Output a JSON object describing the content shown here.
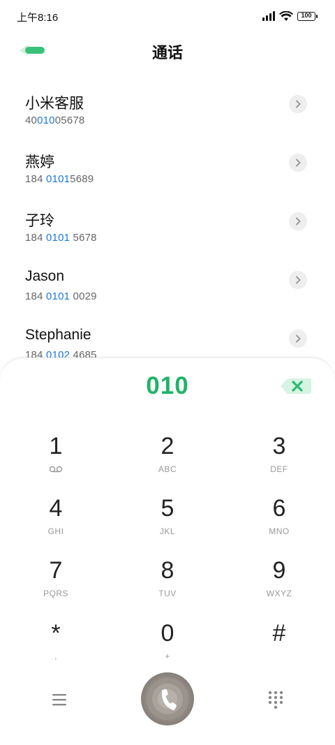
{
  "status_bar": {
    "time": "上午8:16",
    "battery": "100"
  },
  "header": {
    "title": "通话"
  },
  "contacts": [
    {
      "name": "小米客服",
      "number_pre": "40",
      "number_hl": "010",
      "number_post": "05678"
    },
    {
      "name": "燕婷",
      "number_pre": "184 ",
      "number_hl": "0101",
      "number_post": "5689"
    },
    {
      "name": "子玲",
      "number_pre": "184 ",
      "number_hl": "0101",
      "number_post": " 5678"
    },
    {
      "name": "Jason",
      "number_pre": "184 ",
      "number_hl": "0101",
      "number_post": " 0029"
    },
    {
      "name": "Stephanie",
      "number_pre": "184 ",
      "number_hl": "0102",
      "number_post": " 4685"
    }
  ],
  "dialer": {
    "number": "010",
    "keys": [
      {
        "digit": "1",
        "letters": ""
      },
      {
        "digit": "2",
        "letters": "ABC"
      },
      {
        "digit": "3",
        "letters": "DEF"
      },
      {
        "digit": "4",
        "letters": "GHI"
      },
      {
        "digit": "5",
        "letters": "JKL"
      },
      {
        "digit": "6",
        "letters": "MNO"
      },
      {
        "digit": "7",
        "letters": "PQRS"
      },
      {
        "digit": "8",
        "letters": "TUV"
      },
      {
        "digit": "9",
        "letters": "WXYZ"
      },
      {
        "digit": "*",
        "letters": ","
      },
      {
        "digit": "0",
        "letters": "+"
      },
      {
        "digit": "#",
        "letters": ""
      }
    ]
  },
  "colors": {
    "accent_green": "#1fb36a",
    "highlight_blue": "#1a7ad8"
  },
  "icons": {
    "back": "back-arrow-icon",
    "chevron": "chevron-right-icon",
    "delete": "backspace-icon",
    "voicemail": "voicemail-icon",
    "menu": "menu-icon",
    "call": "phone-icon",
    "keypad": "dialpad-icon"
  }
}
